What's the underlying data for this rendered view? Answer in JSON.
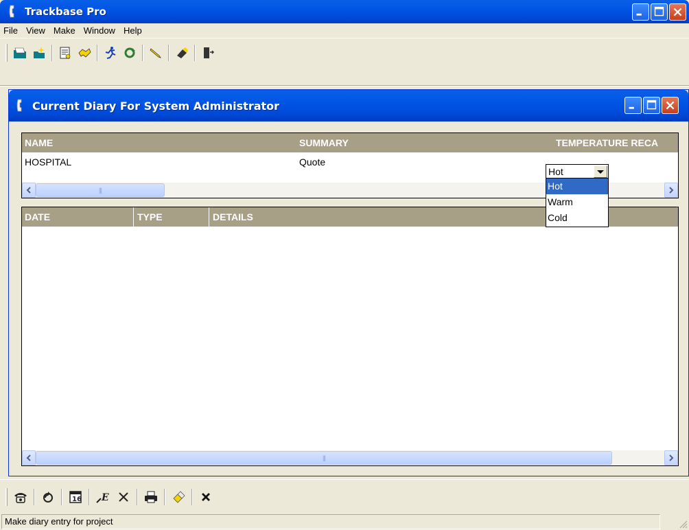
{
  "app": {
    "title": "Trackbase Pro",
    "icon": "phone-handset-icon"
  },
  "menu": [
    "File",
    "View",
    "Make",
    "Window",
    "Help"
  ],
  "toolbar": {
    "buttons": [
      {
        "name": "contacts-button",
        "icon": "folder-teal-icon"
      },
      {
        "name": "new-project-button",
        "icon": "folder-sparkle-icon"
      },
      {
        "name": "notes-button",
        "icon": "notepad-icon"
      },
      {
        "name": "handshake-button",
        "icon": "handshake-icon"
      },
      {
        "name": "run-button",
        "icon": "running-man-icon"
      },
      {
        "name": "refresh-button",
        "icon": "refresh-arrows-icon"
      },
      {
        "name": "pen-button",
        "icon": "pen-icon"
      },
      {
        "name": "eraser-button",
        "icon": "eraser-icon"
      },
      {
        "name": "exit-button",
        "icon": "door-exit-icon"
      }
    ]
  },
  "child_window": {
    "title": "Current Diary For System Administrator"
  },
  "project_grid": {
    "columns": [
      "NAME",
      "SUMMARY",
      "TEMPERATURE RECA"
    ],
    "rows": [
      {
        "name": "HOSPITAL",
        "summary": "Quote",
        "temperature": "Hot"
      }
    ]
  },
  "temperature_dropdown": {
    "selected": "Hot",
    "options": [
      "Hot",
      "Warm",
      "Cold"
    ],
    "highlighted": "Hot"
  },
  "diary_grid": {
    "columns": [
      "DATE",
      "TYPE",
      "DETAILS"
    ],
    "rows": []
  },
  "bottom_toolbar": {
    "buttons": [
      {
        "name": "phone-button",
        "icon": "telephone-icon"
      },
      {
        "name": "recycle-button",
        "icon": "recycle-icon"
      },
      {
        "name": "calendar-button",
        "icon": "calendar-icon"
      },
      {
        "name": "edit-button",
        "icon": "edit-pen-icon"
      },
      {
        "name": "delete-button",
        "icon": "x-icon"
      },
      {
        "name": "print-button",
        "icon": "printer-icon"
      },
      {
        "name": "eraser-button",
        "icon": "eraser-icon"
      },
      {
        "name": "close-button",
        "icon": "x-bold-icon"
      }
    ]
  },
  "status": {
    "text": "Make diary entry for project"
  },
  "colors": {
    "titlebar": "#0055E5",
    "grid_header": "#A8A086",
    "selection": "#316AC5",
    "face": "#ECE9D8"
  }
}
